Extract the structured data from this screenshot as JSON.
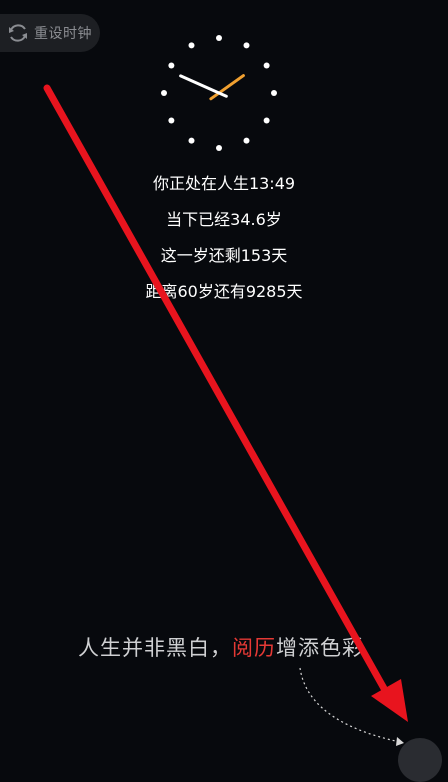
{
  "reset_button": {
    "label": "重设时钟",
    "icon": "refresh-icon"
  },
  "clock": {
    "hour_hand_color": "#f0a030",
    "minute_hand_color": "#ffffff",
    "dot_color": "#ffffff",
    "time": "13:49"
  },
  "life_info": {
    "line1": "你正处在人生13:49",
    "line2": "当下已经34.6岁",
    "line3": "这一岁还剩153天",
    "line4": "距离60岁还有9285天"
  },
  "slogan": {
    "part1": "人生并非黑白，",
    "accent": "阅历",
    "part2": "增添色彩"
  },
  "annotation": {
    "arrow_color": "#e8141e"
  }
}
